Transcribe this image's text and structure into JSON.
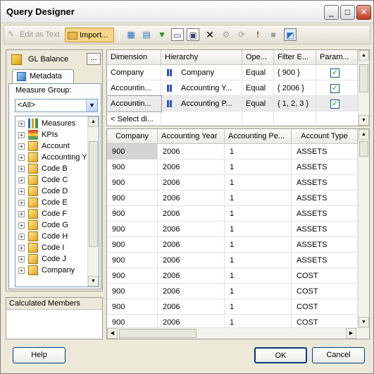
{
  "window": {
    "title": "Query Designer"
  },
  "titlebar_buttons": {
    "minimize": "_",
    "maximize": "□",
    "close": "✕"
  },
  "toolbar": {
    "edit_as_text": "Edit as Text",
    "import": "Import..."
  },
  "cube": {
    "name": "GL Balance",
    "browse": "..."
  },
  "metadata_tab": {
    "label": "Metadata"
  },
  "measure_group": {
    "label": "Measure Group:",
    "selected": "<All>"
  },
  "tree": [
    {
      "label": "Measures",
      "icon": "measures-icon"
    },
    {
      "label": "KPIs",
      "icon": "kpis-icon"
    },
    {
      "label": "Account",
      "icon": "dimension-icon"
    },
    {
      "label": "Accounting Y",
      "icon": "dimension-icon"
    },
    {
      "label": "Code B",
      "icon": "dimension-icon"
    },
    {
      "label": "Code C",
      "icon": "dimension-icon"
    },
    {
      "label": "Code D",
      "icon": "dimension-icon"
    },
    {
      "label": "Code E",
      "icon": "dimension-icon"
    },
    {
      "label": "Code F",
      "icon": "dimension-icon"
    },
    {
      "label": "Code G",
      "icon": "dimension-icon"
    },
    {
      "label": "Code H",
      "icon": "dimension-icon"
    },
    {
      "label": "Code I",
      "icon": "dimension-icon"
    },
    {
      "label": "Code J",
      "icon": "dimension-icon"
    },
    {
      "label": "Company",
      "icon": "dimension-icon"
    }
  ],
  "calculated_members": {
    "label": "Calculated Members"
  },
  "filter_grid": {
    "headers": [
      "Dimension",
      "Hierarchy",
      "Ope...",
      "Filter E...",
      "Param..."
    ],
    "rows": [
      {
        "dimension": "Company",
        "hierarchy": "Company",
        "operator": "Equal",
        "filter": "{ 900 }",
        "param": "✓"
      },
      {
        "dimension": "Accountin...",
        "hierarchy": "Accounting Y...",
        "operator": "Equal",
        "filter": "{ 2006 }",
        "param": "✓"
      },
      {
        "dimension": "Accountin...",
        "hierarchy": "Accounting P...",
        "operator": "Equal",
        "filter": "{ 1, 2, 3 }",
        "param": "✓"
      }
    ],
    "new_row": "< Select di..."
  },
  "data_grid": {
    "headers": [
      "Company",
      "Accounting Year",
      "Accounting Pe...",
      "Account Type"
    ],
    "rows": [
      [
        "900",
        "2006",
        "1",
        "ASSETS"
      ],
      [
        "900",
        "2006",
        "1",
        "ASSETS"
      ],
      [
        "900",
        "2006",
        "1",
        "ASSETS"
      ],
      [
        "900",
        "2006",
        "1",
        "ASSETS"
      ],
      [
        "900",
        "2006",
        "1",
        "ASSETS"
      ],
      [
        "900",
        "2006",
        "1",
        "ASSETS"
      ],
      [
        "900",
        "2006",
        "1",
        "ASSETS"
      ],
      [
        "900",
        "2006",
        "1",
        "ASSETS"
      ],
      [
        "900",
        "2006",
        "1",
        "COST"
      ],
      [
        "900",
        "2006",
        "1",
        "COST"
      ],
      [
        "900",
        "2006",
        "1",
        "COST"
      ],
      [
        "900",
        "2006",
        "1",
        "COST"
      ]
    ]
  },
  "buttons": {
    "help": "Help",
    "ok": "OK",
    "cancel": "Cancel"
  }
}
